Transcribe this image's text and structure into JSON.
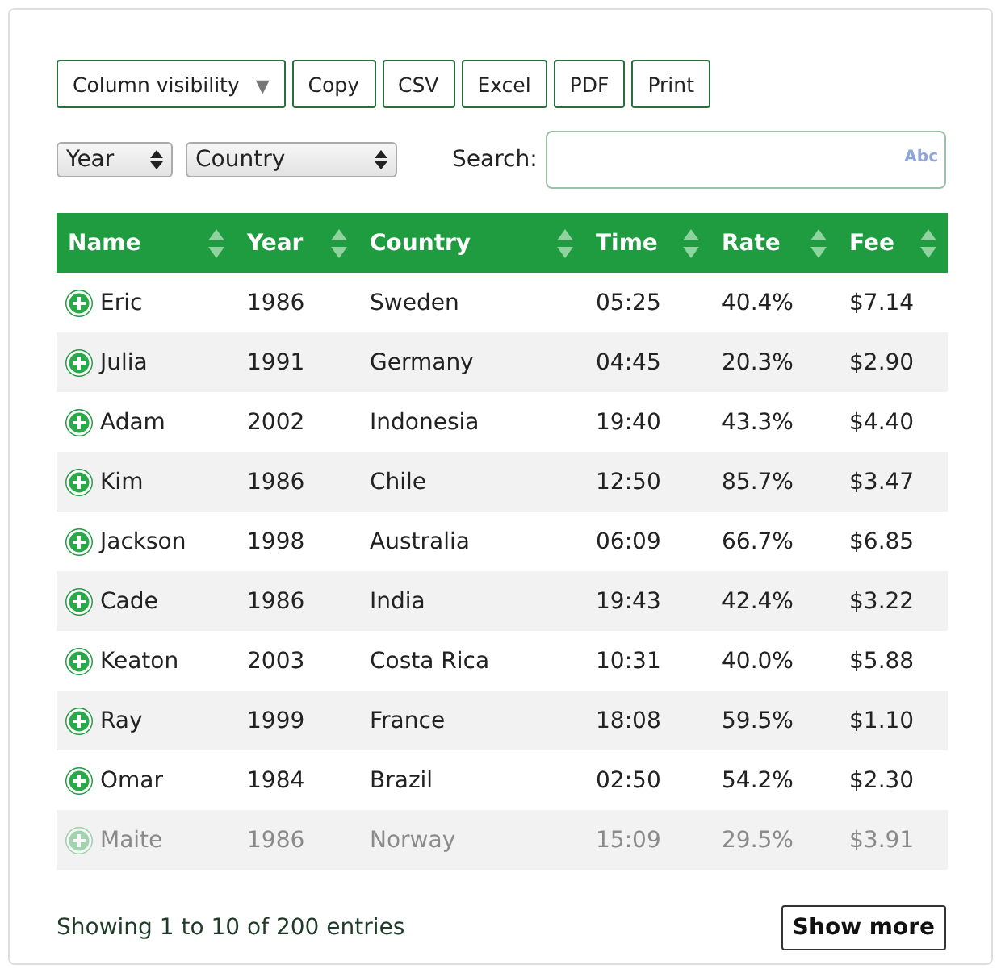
{
  "toolbar": {
    "dropdown": {
      "label": "Column visibility",
      "caret": "▼"
    },
    "buttons": [
      "Copy",
      "CSV",
      "Excel",
      "PDF",
      "Print"
    ]
  },
  "filters": {
    "selects": [
      {
        "value": "Year"
      },
      {
        "value": "Country"
      }
    ],
    "search": {
      "label": "Search:",
      "hint_badge": "Abc"
    }
  },
  "table": {
    "columns": [
      "Name",
      "Year",
      "Country",
      "Time",
      "Rate",
      "Fee"
    ],
    "rows": [
      {
        "cells": [
          "Eric",
          "1986",
          "Sweden",
          "05:25",
          "40.4%",
          "$7.14"
        ],
        "faded": false
      },
      {
        "cells": [
          "Julia",
          "1991",
          "Germany",
          "04:45",
          "20.3%",
          "$2.90"
        ],
        "faded": false
      },
      {
        "cells": [
          "Adam",
          "2002",
          "Indonesia",
          "19:40",
          "43.3%",
          "$4.40"
        ],
        "faded": false
      },
      {
        "cells": [
          "Kim",
          "1986",
          "Chile",
          "12:50",
          "85.7%",
          "$3.47"
        ],
        "faded": false
      },
      {
        "cells": [
          "Jackson",
          "1998",
          "Australia",
          "06:09",
          "66.7%",
          "$6.85"
        ],
        "faded": false
      },
      {
        "cells": [
          "Cade",
          "1986",
          "India",
          "19:43",
          "42.4%",
          "$3.22"
        ],
        "faded": false
      },
      {
        "cells": [
          "Keaton",
          "2003",
          "Costa Rica",
          "10:31",
          "40.0%",
          "$5.88"
        ],
        "faded": false
      },
      {
        "cells": [
          "Ray",
          "1999",
          "France",
          "18:08",
          "59.5%",
          "$1.10"
        ],
        "faded": false
      },
      {
        "cells": [
          "Omar",
          "1984",
          "Brazil",
          "02:50",
          "54.2%",
          "$2.30"
        ],
        "faded": false
      },
      {
        "cells": [
          "Maite",
          "1986",
          "Norway",
          "15:09",
          "29.5%",
          "$3.91"
        ],
        "faded": true
      }
    ]
  },
  "footer": {
    "info": "Showing 1 to 10 of 200 entries",
    "button": "Show more"
  }
}
